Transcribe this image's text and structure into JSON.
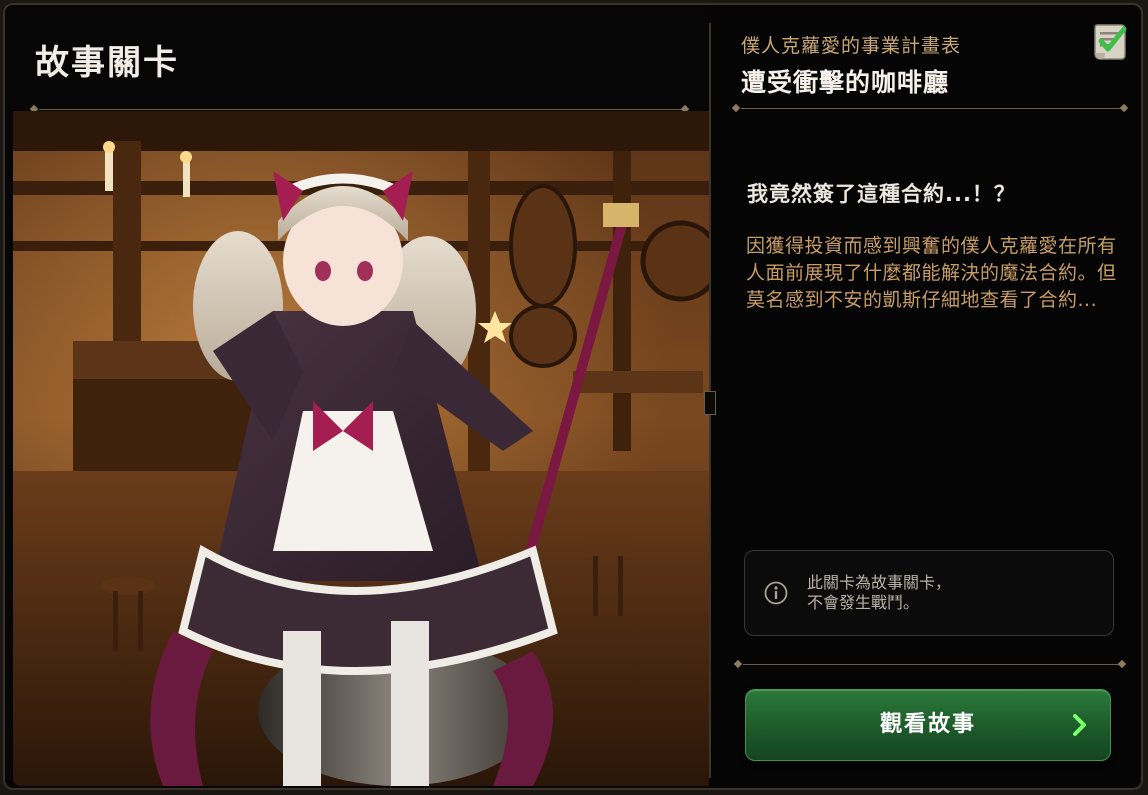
{
  "left_panel": {
    "title": "故事關卡"
  },
  "right_panel": {
    "subtitle": "僕人克蘿愛的事業計畫表",
    "stage_title": "遭受衝擊的咖啡廳",
    "heading": "我竟然簽了這種合約...！？",
    "description": "因獲得投資而感到興奮的僕人克蘿愛在所有人面前展現了什麼都能解決的魔法合約。但莫名感到不安的凱斯仔細地查看了合約...",
    "info_text": "此關卡為故事關卡，\n不會發生戰鬥。",
    "watch_button_label": "觀看故事"
  },
  "icons": {
    "top_right": "checklist-icon",
    "info": "info-icon",
    "button_arrow": "chevron-right-icon"
  },
  "colors": {
    "accent_gold": "#c9a873",
    "description_text": "#c79d63",
    "button_green": "#1c5a2a",
    "chevron_green": "#7dff6a"
  }
}
